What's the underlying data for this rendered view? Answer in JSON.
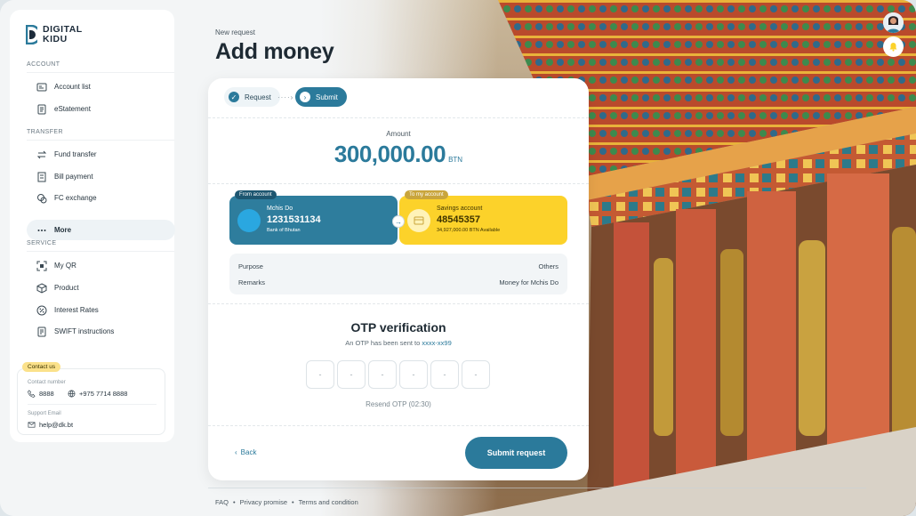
{
  "app": {
    "logo_line1": "DIGITAL",
    "logo_line2": "KIDU"
  },
  "sidebar": {
    "account_section": "ACCOUNT",
    "transfer_section": "TRANSFER",
    "service_section": "SERVICE",
    "items": [
      {
        "label": "Account list",
        "icon": "account-list-icon"
      },
      {
        "label": "eStatement",
        "icon": "statement-icon"
      },
      {
        "label": "Fund transfer",
        "icon": "transfer-icon"
      },
      {
        "label": "Bill payment",
        "icon": "bill-icon"
      },
      {
        "label": "FC exchange",
        "icon": "exchange-icon"
      },
      {
        "label": "More",
        "icon": "more-icon"
      },
      {
        "label": "My QR",
        "icon": "qr-icon"
      },
      {
        "label": "Product",
        "icon": "product-icon"
      },
      {
        "label": "Interest Rates",
        "icon": "percent-icon"
      },
      {
        "label": "SWIFT instructions",
        "icon": "swift-icon"
      }
    ],
    "contact": {
      "badge": "Contact us",
      "number_label": "Contact number",
      "phone1": "8888",
      "phone2": "+975 7714 8888",
      "email_label": "Support Email",
      "email": "help@dk.bt"
    }
  },
  "header": {
    "breadcrumb": "New request",
    "title": "Add money"
  },
  "steps": {
    "step1": "Request",
    "step2": "Submit"
  },
  "amount": {
    "label": "Amount",
    "value": "300,000.00",
    "currency": "BTN"
  },
  "from_account": {
    "tag": "From account",
    "name": "Mchis Do",
    "number": "1231531134",
    "bank": "Bank of Bhutan"
  },
  "to_account": {
    "tag": "To my account",
    "name": "Savings account",
    "number": "48545357",
    "available": "34,927,000.00 BTN Available"
  },
  "details": {
    "purpose_label": "Purpose",
    "purpose_value": "Others",
    "remarks_label": "Remarks",
    "remarks_value": "Money for Mchis Do"
  },
  "otp": {
    "title": "OTP verification",
    "sub_text": "An OTP has been sent to",
    "phone": "xxxx-xx99",
    "placeholder": "-",
    "resend": "Resend OTP (02:30)"
  },
  "actions": {
    "back": "Back",
    "submit": "Submit request"
  },
  "footer": {
    "faq": "FAQ",
    "privacy": "Privacy promise",
    "terms": "Terms and condition",
    "sep": "•"
  },
  "colors": {
    "primary": "#2b7a9b",
    "accent": "#fcd22a",
    "from_card": "#2e7d9d"
  }
}
